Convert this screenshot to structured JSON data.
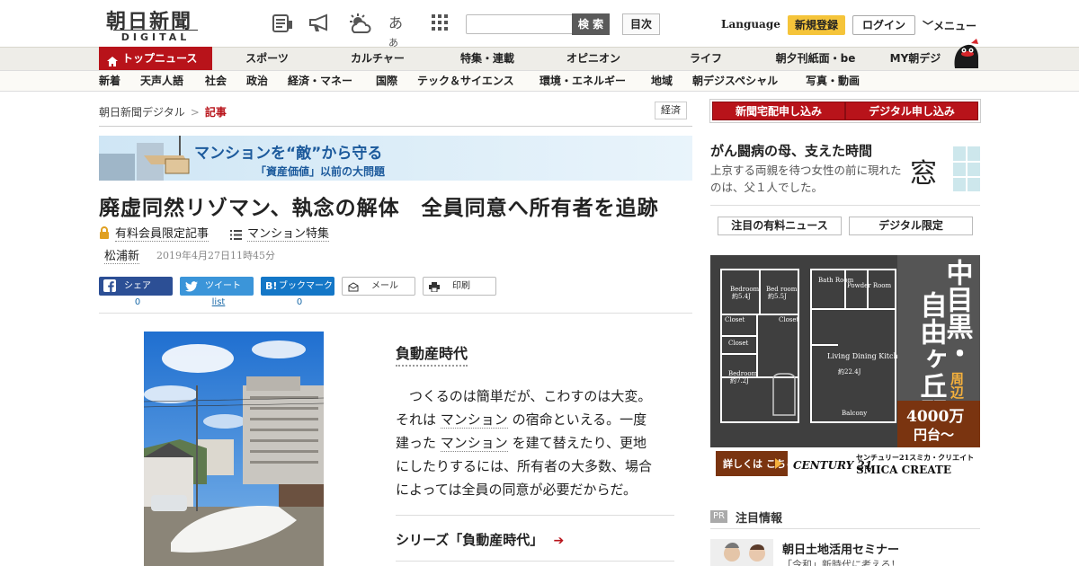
{
  "header": {
    "logo_jp": "朝日新聞",
    "logo_en": "DIGITAL",
    "icons": [
      "newspaper-icon",
      "megaphone-icon",
      "weather-icon",
      "font-size-icon",
      "grid-icon"
    ],
    "search_button": "検 索",
    "toc_button": "目次",
    "language": "Language",
    "register": "新規登録",
    "login": "ログイン",
    "menu": "メニュー"
  },
  "nav_main": {
    "active": "トップニュース",
    "items": [
      "スポーツ",
      "カルチャー",
      "特集・連載",
      "オピニオン",
      "ライフ",
      "朝夕刊紙面・be",
      "MY朝デジ"
    ]
  },
  "nav_sub": [
    "新着",
    "天声人語",
    "社会",
    "政治",
    "経済・マネー",
    "国際",
    "テック＆サイエンス",
    "環境・エネルギー",
    "地域",
    "朝デジスペシャル",
    "写真・動画"
  ],
  "breadcrumb": {
    "home": "朝日新聞デジタル",
    "separator": ">",
    "current": "記事"
  },
  "category_tag": "経済",
  "banner": {
    "line1": "マンションを“敵”から守る",
    "line2": "「資産価値」以前の大問題"
  },
  "article": {
    "headline": "廃虚同然リゾマン、執念の解体　全員同意へ所有者を追跡",
    "member_tag": "有料会員限定記事",
    "series_tag": "マンション特集",
    "author": "松浦新",
    "date": "2019年4月27日11時45分",
    "section_title": "負動産時代",
    "body": {
      "p1": "　つくるのは簡単だが、こわすのは大変。",
      "p2a": "それは",
      "kw1": "マンション",
      "p2b": "の宿命といえる。一度",
      "p3a": "建った",
      "kw2": "マンション",
      "p3b": "を建て替えたり、更地",
      "p4": "にしたりするには、所有者の大多数、場合",
      "p5": "によっては全員の同意が必要だからだ。"
    },
    "series_link": "シリーズ「負動産時代」"
  },
  "share": {
    "facebook": {
      "label": "シェア",
      "count": "0"
    },
    "twitter": {
      "label": "ツイート",
      "count": "list"
    },
    "hatena": {
      "label": "ブックマーク",
      "count": "0"
    },
    "mail": {
      "label": "メール"
    },
    "print": {
      "label": "印刷"
    }
  },
  "sidebar": {
    "subscribe_home": "新聞宅配申し込み",
    "subscribe_digital": "デジタル申し込み",
    "column_title": "がん闘病の母、支えた時間",
    "column_text": "上京する両親を待つ女性の前に現れたのは、父１人でした。",
    "column_badge": "窓",
    "paid_news_button": "注目の有料ニュース",
    "digital_only_button": "デジタル限定",
    "pr_label": "PR",
    "pr_title": "注目情報",
    "pr_item_title": "朝日土地活用セミナー",
    "pr_item_sub": "「令和」新時代に考える！"
  },
  "ad": {
    "rooms": [
      "Bedroom",
      "約5.4J",
      "Bed room",
      "約5.5J",
      "Closet",
      "Closet",
      "Closet",
      "Bedroom",
      "約7.2J",
      "Bath Room",
      "Powder Room",
      "Living Dining Kitchen",
      "約22.4J",
      "Balcony"
    ],
    "vertical_text_1": "自由ヶ丘駅",
    "vertical_text_2": "中目黒・",
    "vertical_text_2b": "周辺",
    "price": "4000万",
    "price_suffix": "円台～",
    "cta": "詳しくは こちら",
    "brand": "CENTURY 21",
    "company_jp": "センチュリー21スミカ・クリエイト",
    "company_en": "SMICA CREATE"
  },
  "colors": {
    "brand_red": "#b8131a",
    "facebook": "#2c4f95",
    "twitter": "#3b95d9",
    "hatena": "#1477c7",
    "register_yellow": "#f5c43a"
  }
}
